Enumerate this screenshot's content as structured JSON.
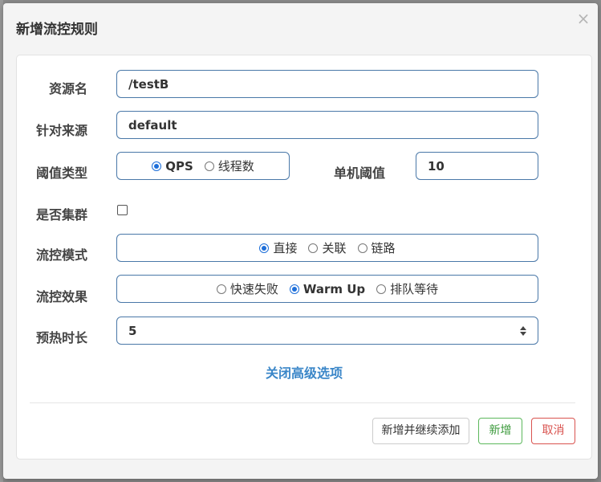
{
  "dialog": {
    "title": "新增流控规则",
    "close_glyph": "×"
  },
  "form": {
    "resource": {
      "label": "资源名",
      "value": "/testB"
    },
    "limit_app": {
      "label": "针对来源",
      "value": "default"
    },
    "threshold_type": {
      "label": "阈值类型",
      "options": [
        "QPS",
        "线程数"
      ],
      "selected": "QPS"
    },
    "single_threshold": {
      "label": "单机阈值",
      "value": "10"
    },
    "cluster": {
      "label": "是否集群",
      "checked": false
    },
    "control_mode": {
      "label": "流控模式",
      "options": [
        "直接",
        "关联",
        "链路"
      ],
      "selected": "直接"
    },
    "control_effect": {
      "label": "流控效果",
      "options": [
        "快速失败",
        "Warm Up",
        "排队等待"
      ],
      "selected": "Warm Up"
    },
    "warmup_period": {
      "label": "预热时长",
      "value": "5"
    },
    "advanced_toggle": "关闭高级选项"
  },
  "footer": {
    "add_continue": "新增并继续添加",
    "add": "新增",
    "cancel": "取消"
  },
  "colors": {
    "accent_blue": "#3a86c8",
    "success_green": "#5cb85c",
    "danger_red": "#d9534f",
    "field_border": "#4a78a8"
  }
}
